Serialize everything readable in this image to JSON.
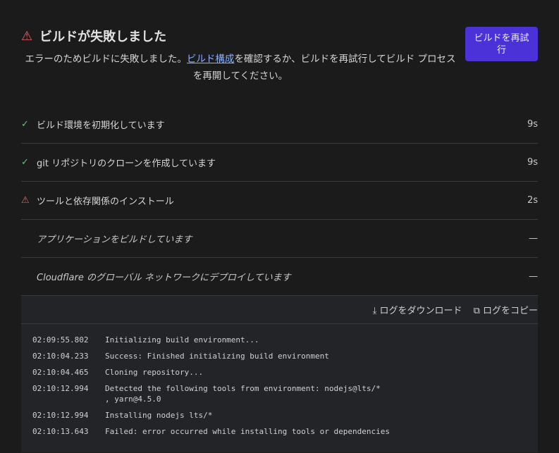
{
  "header": {
    "title": "ビルドが失敗しました",
    "desc_pre": "エラーのためビルドに失敗しました。",
    "desc_link": "ビルド構成",
    "desc_post": "を確認するか、ビルドを再試行してビルド プロセスを再開してください。",
    "retry_label": "ビルドを再試行",
    "warning_icon": "warning-triangle",
    "accent": "#4a31d8"
  },
  "steps": [
    {
      "label": "ビルド環境を初期化しています",
      "duration": "9s",
      "status": "success"
    },
    {
      "label": "git リポジトリのクローンを作成しています",
      "duration": "9s",
      "status": "success"
    },
    {
      "label": "ツールと依存関係のインストール",
      "duration": "2s",
      "status": "failed"
    },
    {
      "label": "アプリケーションをビルドしています",
      "duration": "—",
      "status": "pending"
    },
    {
      "label": "Cloudflare のグローバル ネットワークにデプロイしています",
      "duration": "—",
      "status": "pending"
    }
  ],
  "log": {
    "download_label": "ログをダウンロード",
    "copy_label": "ログをコピー",
    "lines": [
      {
        "time": "02:09:55.802",
        "text": "Initializing build environment..."
      },
      {
        "time": "02:10:04.233",
        "text": "Success: Finished initializing build environment"
      },
      {
        "time": "02:10:04.465",
        "text": "Cloning repository..."
      },
      {
        "time": "02:10:12.994",
        "text": "Detected the following tools from environment: nodejs@lts/*\n, yarn@4.5.0"
      },
      {
        "time": "02:10:12.994",
        "text": "Installing nodejs lts/*"
      },
      {
        "time": "02:10:13.643",
        "text": "Failed: error occurred while installing tools or dependencies"
      }
    ]
  }
}
